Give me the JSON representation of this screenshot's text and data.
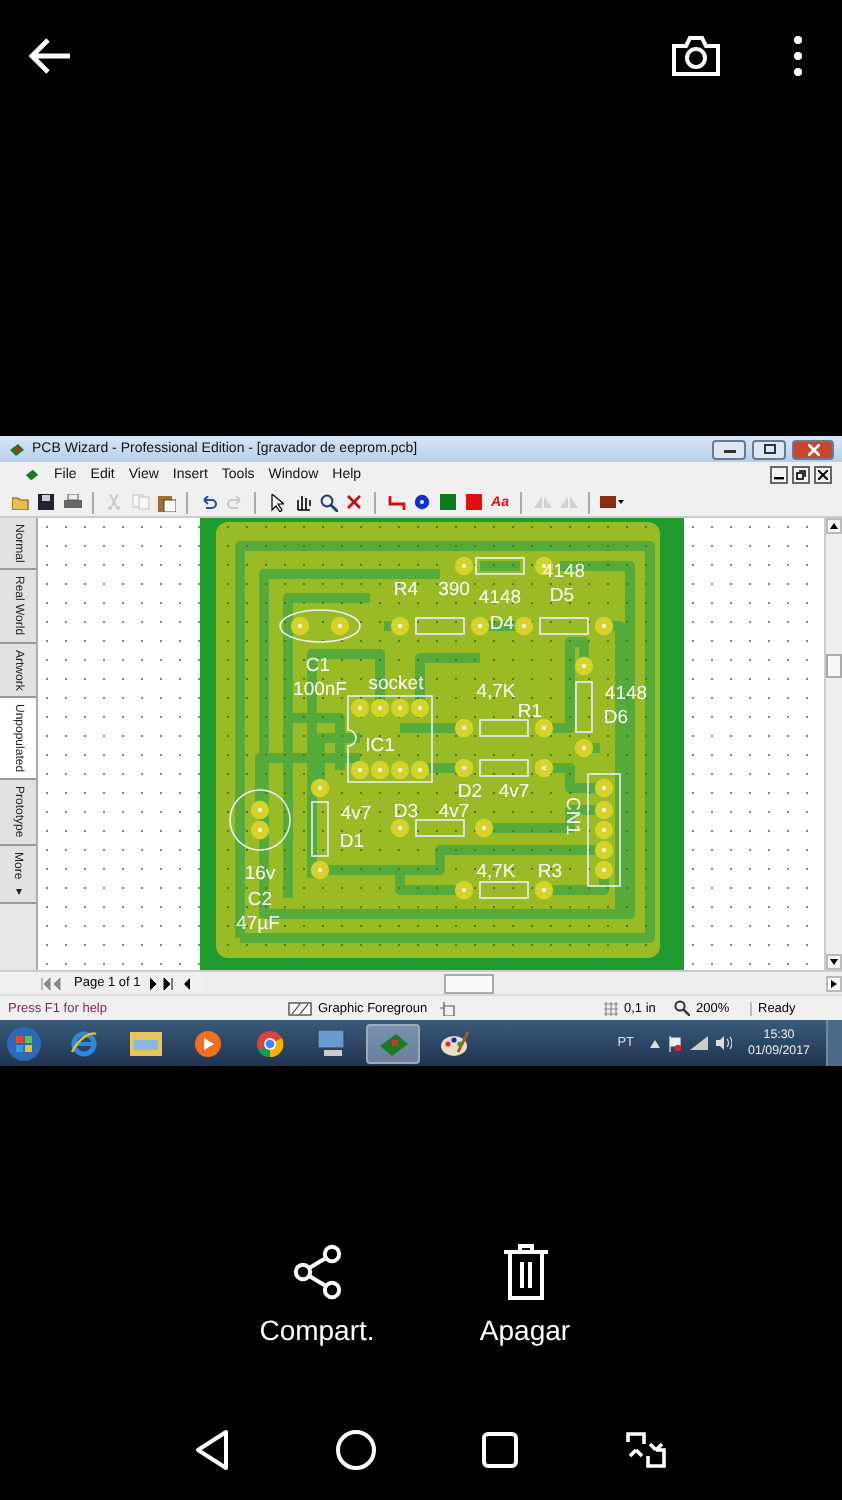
{
  "window": {
    "title": "PCB Wizard - Professional Edition - [gravador de eeprom.pcb]"
  },
  "menu": [
    "File",
    "Edit",
    "View",
    "Insert",
    "Tools",
    "Window",
    "Help"
  ],
  "toolbar": [
    {
      "kind": "open",
      "disabled": false
    },
    {
      "kind": "save",
      "disabled": false
    },
    {
      "kind": "print",
      "disabled": false
    },
    {
      "kind": "cut",
      "disabled": true
    },
    {
      "kind": "copy",
      "disabled": true
    },
    {
      "kind": "paste",
      "disabled": false
    },
    {
      "kind": "undo",
      "disabled": false
    },
    {
      "kind": "redo",
      "disabled": true
    },
    {
      "kind": "select",
      "disabled": false
    },
    {
      "kind": "hand",
      "disabled": false
    },
    {
      "kind": "zoom",
      "disabled": false
    },
    {
      "kind": "delete",
      "disabled": false
    },
    {
      "kind": "track",
      "disabled": false
    },
    {
      "kind": "round-pad",
      "disabled": false
    },
    {
      "kind": "square-pad",
      "disabled": false
    },
    {
      "kind": "red-pad",
      "disabled": false
    },
    {
      "kind": "text",
      "label": "Aa",
      "disabled": false
    },
    {
      "kind": "flip",
      "disabled": true
    },
    {
      "kind": "flip",
      "disabled": true
    },
    {
      "kind": "component",
      "disabled": false
    }
  ],
  "view_tabs": [
    {
      "label": "Normal",
      "selected": false
    },
    {
      "label": "Real World",
      "selected": false
    },
    {
      "label": "Artwork",
      "selected": false
    },
    {
      "label": "Unpopulated",
      "selected": true
    },
    {
      "label": "Prototype",
      "selected": false
    },
    {
      "label": "More ▾",
      "selected": false
    }
  ],
  "board_labels": [
    "4148",
    "D5",
    "R4",
    "390",
    "4148",
    "D4",
    "C1",
    "100nF",
    "socket",
    "4,7K",
    "4148",
    "R1",
    "D6",
    "IC1",
    "D2",
    "4v7",
    "4v7",
    "D3",
    "4v7",
    "CN1",
    "D1",
    "16v",
    "4,7K",
    "R3",
    "C2",
    "47µF"
  ],
  "page_nav": "Page 1 of 1",
  "status_bar": {
    "help": "Press F1 for help",
    "layer": "Graphic Foregroun",
    "grid": "0,1 in",
    "zoom": "200%",
    "state": "Ready"
  },
  "taskbar": {
    "apps": [
      {
        "kind": "ie",
        "selected": false
      },
      {
        "kind": "folder",
        "selected": false
      },
      {
        "kind": "media",
        "selected": false
      },
      {
        "kind": "chrome",
        "selected": false
      },
      {
        "kind": "computer",
        "selected": false
      },
      {
        "kind": "pcb",
        "selected": true
      },
      {
        "kind": "paint",
        "selected": false
      }
    ],
    "language": "PT",
    "time": "15:30",
    "date": "01/09/2017"
  },
  "actions": [
    {
      "kind": "share",
      "label": "Compart."
    },
    {
      "kind": "delete",
      "label": "Apagar"
    }
  ]
}
